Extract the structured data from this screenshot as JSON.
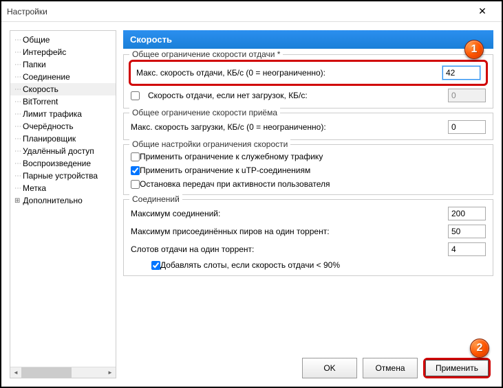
{
  "window": {
    "title": "Настройки"
  },
  "sidebar": {
    "items": [
      {
        "label": "Общие"
      },
      {
        "label": "Интерфейс"
      },
      {
        "label": "Папки"
      },
      {
        "label": "Соединение"
      },
      {
        "label": "Скорость"
      },
      {
        "label": "BitTorrent"
      },
      {
        "label": "Лимит трафика"
      },
      {
        "label": "Очерёдность"
      },
      {
        "label": "Планировщик"
      },
      {
        "label": "Удалённый доступ"
      },
      {
        "label": "Воспроизведение"
      },
      {
        "label": "Парные устройства"
      },
      {
        "label": "Метка"
      },
      {
        "label": "Дополнительно"
      }
    ]
  },
  "panel": {
    "title": "Скорость"
  },
  "upload": {
    "legend": "Общее ограничение скорости отдачи *",
    "max_label": "Макс. скорость отдачи, КБ/с (0 = неограниченно):",
    "max_value": "42",
    "alt_label": "Скорость отдачи, если нет загрузок, КБ/c:",
    "alt_value": "0"
  },
  "download": {
    "legend": "Общее ограничение скорости приёма",
    "max_label": "Макс. скорость загрузки, КБ/с (0 = неограниченно):",
    "max_value": "0"
  },
  "general": {
    "legend": "Общие настройки ограничения скорости",
    "opt1": "Применить ограничение к служебному трафику",
    "opt2": "Применить ограничение к uTP-соединениям",
    "opt3": "Остановка передач при активности пользователя"
  },
  "connections": {
    "legend": "Соединений",
    "max_conn_label": "Максимум соединений:",
    "max_conn_value": "200",
    "max_peers_label": "Максимум присоединённых пиров на один торрент:",
    "max_peers_value": "50",
    "slots_label": "Слотов отдачи на один торрент:",
    "slots_value": "4",
    "extra_slots": "Добавлять слоты, если скорость отдачи < 90%"
  },
  "buttons": {
    "ok": "OK",
    "cancel": "Отмена",
    "apply": "Применить"
  },
  "badges": {
    "one": "1",
    "two": "2"
  }
}
